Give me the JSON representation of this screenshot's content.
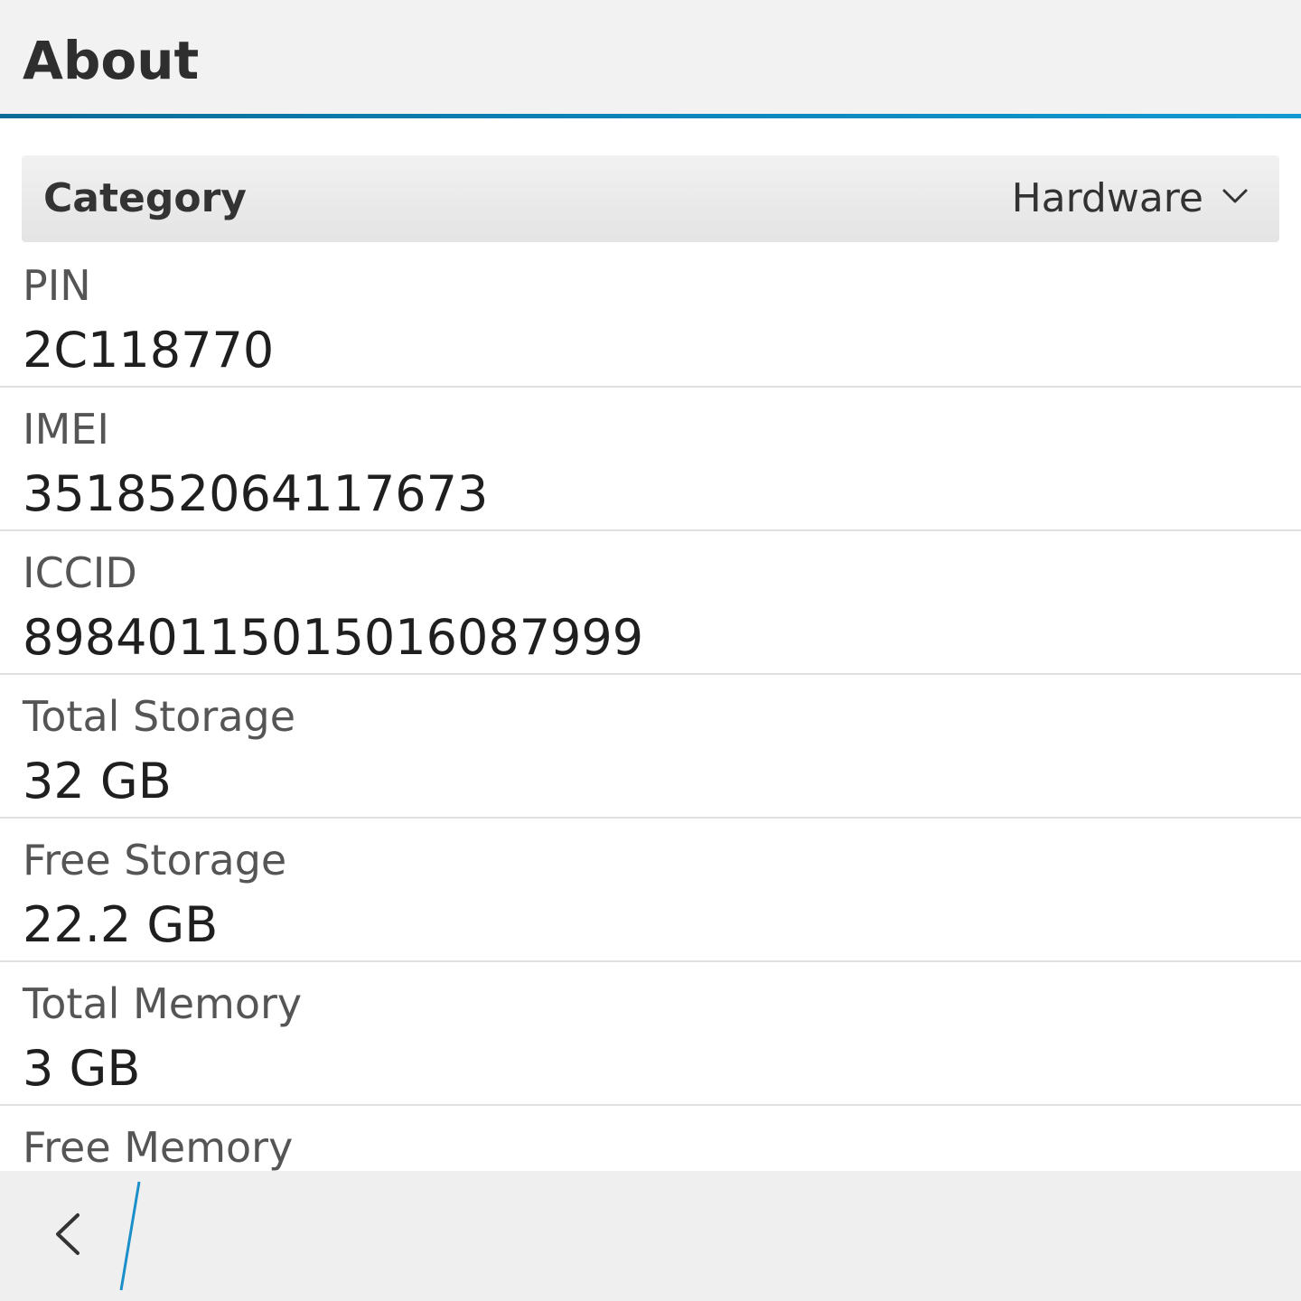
{
  "header": {
    "title": "About",
    "accent_color": "#0c87bd"
  },
  "category_selector": {
    "label": "Category",
    "selected": "Hardware",
    "icon": "chevron-down-icon"
  },
  "items": [
    {
      "label": "PIN",
      "value": "2C118770"
    },
    {
      "label": "IMEI",
      "value": "351852064117673"
    },
    {
      "label": "ICCID",
      "value": "89840115015016087999"
    },
    {
      "label": "Total Storage",
      "value": "32 GB"
    },
    {
      "label": "Free Storage",
      "value": "22.2 GB"
    },
    {
      "label": "Total Memory",
      "value": "3 GB"
    },
    {
      "label": "Free Memory",
      "value": ""
    }
  ],
  "footer": {
    "back_icon": "chevron-left-icon"
  }
}
